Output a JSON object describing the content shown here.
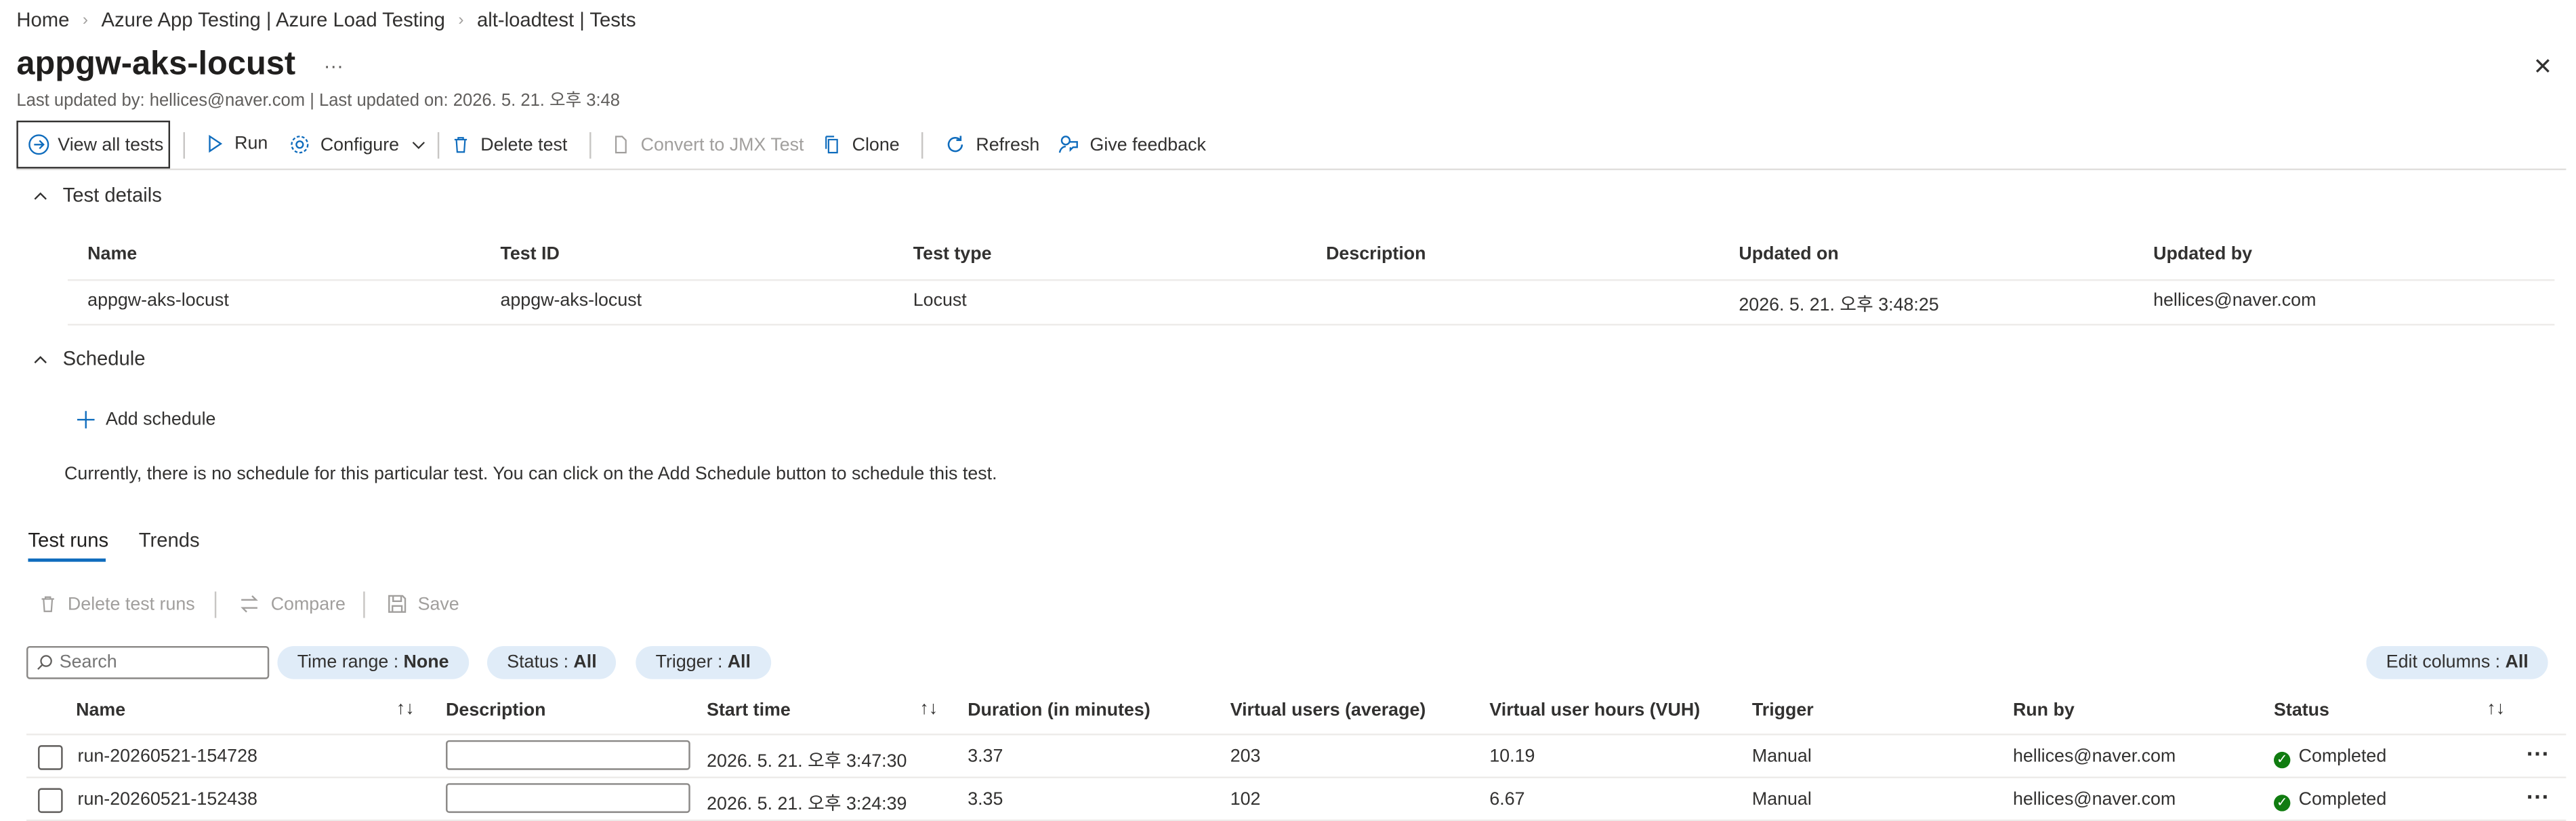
{
  "breadcrumb": [
    "Home",
    "Azure App Testing | Azure Load Testing",
    "alt-loadtest | Tests"
  ],
  "breadcrumb_separator": "›",
  "page": {
    "title": "appgw-aks-locust",
    "more": "···",
    "subtitle": "Last updated by: hellices@naver.com | Last updated on: 2026. 5. 21. 오후 3:48",
    "close": "✕"
  },
  "toolbar": {
    "view_all_tests": "View all tests",
    "run": "Run",
    "configure": "Configure",
    "delete_test": "Delete test",
    "convert_jmx": "Convert to JMX Test",
    "clone": "Clone",
    "refresh": "Refresh",
    "give_feedback": "Give feedback"
  },
  "test_details": {
    "section_title": "Test details",
    "headers": [
      "Name",
      "Test ID",
      "Test type",
      "Description",
      "Updated on",
      "Updated by"
    ],
    "row": [
      "appgw-aks-locust",
      "appgw-aks-locust",
      "Locust",
      "",
      "2026. 5. 21. 오후 3:48:25",
      "hellices@naver.com"
    ]
  },
  "schedule": {
    "section_title": "Schedule",
    "add_schedule": "Add schedule",
    "message": "Currently, there is no schedule for this particular test. You can click on the Add Schedule button to schedule this test."
  },
  "tabs": {
    "test_runs": "Test runs",
    "trends": "Trends",
    "active": "Test runs"
  },
  "runs_toolbar": {
    "delete_runs": "Delete test runs",
    "compare": "Compare",
    "save": "Save"
  },
  "filters": {
    "search_placeholder": "Search",
    "time_range_label": "Time range :",
    "time_range_value": "None",
    "status_label": "Status :",
    "status_value": "All",
    "trigger_label": "Trigger :",
    "trigger_value": "All",
    "edit_columns_label": "Edit columns :",
    "edit_columns_value": "All"
  },
  "runs_table": {
    "headers": [
      "Name",
      "Description",
      "Start time",
      "Duration (in minutes)",
      "Virtual users (average)",
      "Virtual user hours (VUH)",
      "Trigger",
      "Run by",
      "Status"
    ],
    "sort_icon": "↑↓",
    "rows": [
      {
        "name": "run-20260521-154728",
        "description": "",
        "start": "2026. 5. 21. 오후 3:47:30",
        "duration": "3.37",
        "vu_avg": "203",
        "vuh": "10.19",
        "trigger": "Manual",
        "run_by": "hellices@naver.com",
        "status": "Completed",
        "more": "···"
      },
      {
        "name": "run-20260521-152438",
        "description": "",
        "start": "2026. 5. 21. 오후 3:24:39",
        "duration": "3.35",
        "vu_avg": "102",
        "vuh": "6.67",
        "trigger": "Manual",
        "run_by": "hellices@naver.com",
        "status": "Completed",
        "more": "···"
      }
    ]
  },
  "colors": {
    "accent": "#0f6cbd",
    "success": "#107c10",
    "pill_bg": "#e0ecf8"
  }
}
